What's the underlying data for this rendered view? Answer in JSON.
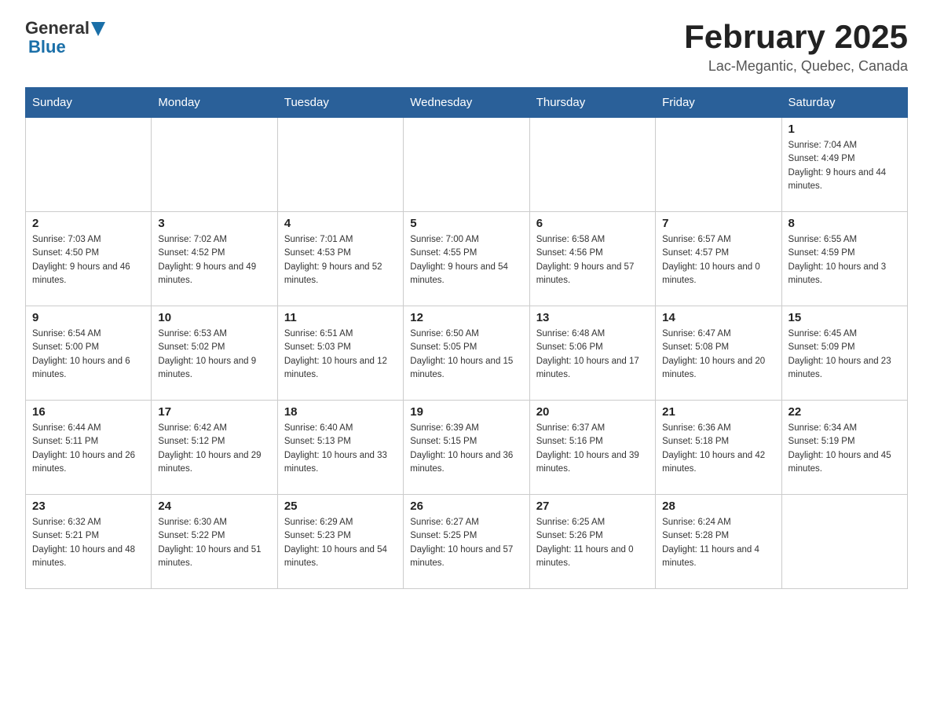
{
  "header": {
    "logo_general": "General",
    "logo_blue": "Blue",
    "title": "February 2025",
    "subtitle": "Lac-Megantic, Quebec, Canada"
  },
  "weekdays": [
    "Sunday",
    "Monday",
    "Tuesday",
    "Wednesday",
    "Thursday",
    "Friday",
    "Saturday"
  ],
  "weeks": [
    [
      {
        "day": "",
        "info": ""
      },
      {
        "day": "",
        "info": ""
      },
      {
        "day": "",
        "info": ""
      },
      {
        "day": "",
        "info": ""
      },
      {
        "day": "",
        "info": ""
      },
      {
        "day": "",
        "info": ""
      },
      {
        "day": "1",
        "info": "Sunrise: 7:04 AM\nSunset: 4:49 PM\nDaylight: 9 hours and 44 minutes."
      }
    ],
    [
      {
        "day": "2",
        "info": "Sunrise: 7:03 AM\nSunset: 4:50 PM\nDaylight: 9 hours and 46 minutes."
      },
      {
        "day": "3",
        "info": "Sunrise: 7:02 AM\nSunset: 4:52 PM\nDaylight: 9 hours and 49 minutes."
      },
      {
        "day": "4",
        "info": "Sunrise: 7:01 AM\nSunset: 4:53 PM\nDaylight: 9 hours and 52 minutes."
      },
      {
        "day": "5",
        "info": "Sunrise: 7:00 AM\nSunset: 4:55 PM\nDaylight: 9 hours and 54 minutes."
      },
      {
        "day": "6",
        "info": "Sunrise: 6:58 AM\nSunset: 4:56 PM\nDaylight: 9 hours and 57 minutes."
      },
      {
        "day": "7",
        "info": "Sunrise: 6:57 AM\nSunset: 4:57 PM\nDaylight: 10 hours and 0 minutes."
      },
      {
        "day": "8",
        "info": "Sunrise: 6:55 AM\nSunset: 4:59 PM\nDaylight: 10 hours and 3 minutes."
      }
    ],
    [
      {
        "day": "9",
        "info": "Sunrise: 6:54 AM\nSunset: 5:00 PM\nDaylight: 10 hours and 6 minutes."
      },
      {
        "day": "10",
        "info": "Sunrise: 6:53 AM\nSunset: 5:02 PM\nDaylight: 10 hours and 9 minutes."
      },
      {
        "day": "11",
        "info": "Sunrise: 6:51 AM\nSunset: 5:03 PM\nDaylight: 10 hours and 12 minutes."
      },
      {
        "day": "12",
        "info": "Sunrise: 6:50 AM\nSunset: 5:05 PM\nDaylight: 10 hours and 15 minutes."
      },
      {
        "day": "13",
        "info": "Sunrise: 6:48 AM\nSunset: 5:06 PM\nDaylight: 10 hours and 17 minutes."
      },
      {
        "day": "14",
        "info": "Sunrise: 6:47 AM\nSunset: 5:08 PM\nDaylight: 10 hours and 20 minutes."
      },
      {
        "day": "15",
        "info": "Sunrise: 6:45 AM\nSunset: 5:09 PM\nDaylight: 10 hours and 23 minutes."
      }
    ],
    [
      {
        "day": "16",
        "info": "Sunrise: 6:44 AM\nSunset: 5:11 PM\nDaylight: 10 hours and 26 minutes."
      },
      {
        "day": "17",
        "info": "Sunrise: 6:42 AM\nSunset: 5:12 PM\nDaylight: 10 hours and 29 minutes."
      },
      {
        "day": "18",
        "info": "Sunrise: 6:40 AM\nSunset: 5:13 PM\nDaylight: 10 hours and 33 minutes."
      },
      {
        "day": "19",
        "info": "Sunrise: 6:39 AM\nSunset: 5:15 PM\nDaylight: 10 hours and 36 minutes."
      },
      {
        "day": "20",
        "info": "Sunrise: 6:37 AM\nSunset: 5:16 PM\nDaylight: 10 hours and 39 minutes."
      },
      {
        "day": "21",
        "info": "Sunrise: 6:36 AM\nSunset: 5:18 PM\nDaylight: 10 hours and 42 minutes."
      },
      {
        "day": "22",
        "info": "Sunrise: 6:34 AM\nSunset: 5:19 PM\nDaylight: 10 hours and 45 minutes."
      }
    ],
    [
      {
        "day": "23",
        "info": "Sunrise: 6:32 AM\nSunset: 5:21 PM\nDaylight: 10 hours and 48 minutes."
      },
      {
        "day": "24",
        "info": "Sunrise: 6:30 AM\nSunset: 5:22 PM\nDaylight: 10 hours and 51 minutes."
      },
      {
        "day": "25",
        "info": "Sunrise: 6:29 AM\nSunset: 5:23 PM\nDaylight: 10 hours and 54 minutes."
      },
      {
        "day": "26",
        "info": "Sunrise: 6:27 AM\nSunset: 5:25 PM\nDaylight: 10 hours and 57 minutes."
      },
      {
        "day": "27",
        "info": "Sunrise: 6:25 AM\nSunset: 5:26 PM\nDaylight: 11 hours and 0 minutes."
      },
      {
        "day": "28",
        "info": "Sunrise: 6:24 AM\nSunset: 5:28 PM\nDaylight: 11 hours and 4 minutes."
      },
      {
        "day": "",
        "info": ""
      }
    ]
  ]
}
